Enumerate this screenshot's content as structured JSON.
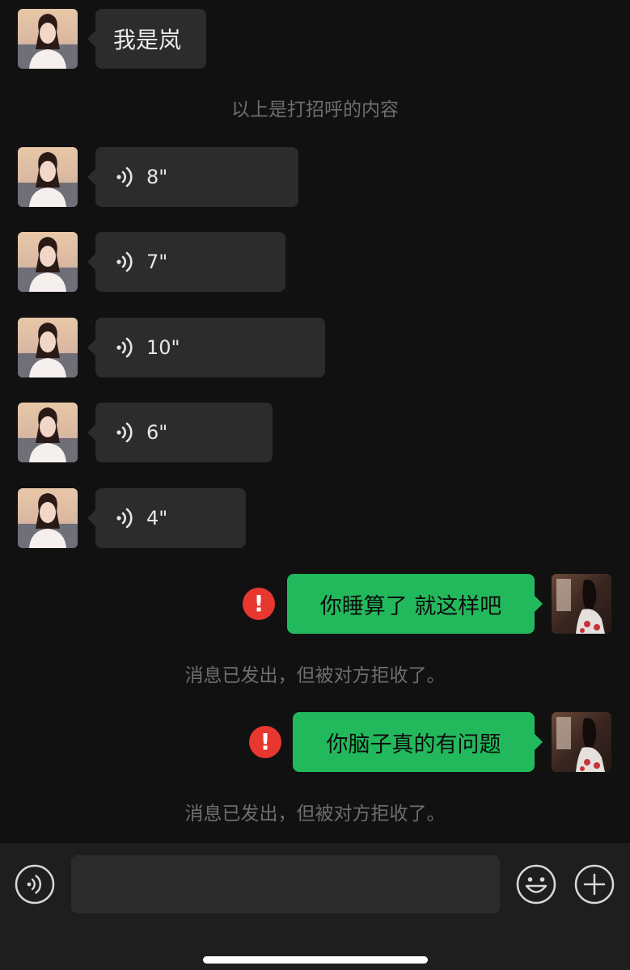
{
  "messages": {
    "greeting_text": "我是岚",
    "greeting_note": "以上是打招呼的内容",
    "voice_1": "8\"",
    "voice_2": "7\"",
    "voice_3": "10\"",
    "voice_4": "6\"",
    "voice_5": "4\"",
    "out_1": "你睡算了 就这样吧",
    "out_2": "你脑子真的有问题",
    "rejected_notice": "消息已发出，但被对方拒收了。",
    "error_mark": "!"
  },
  "colors": {
    "background": "#111111",
    "incoming_bubble": "#2c2c2c",
    "outgoing_bubble": "#22b95c",
    "error": "#e8372f"
  },
  "icons": {
    "voice": "voice-wave-icon",
    "emoji": "smiley-face-icon",
    "plus": "plus-circle-icon"
  }
}
